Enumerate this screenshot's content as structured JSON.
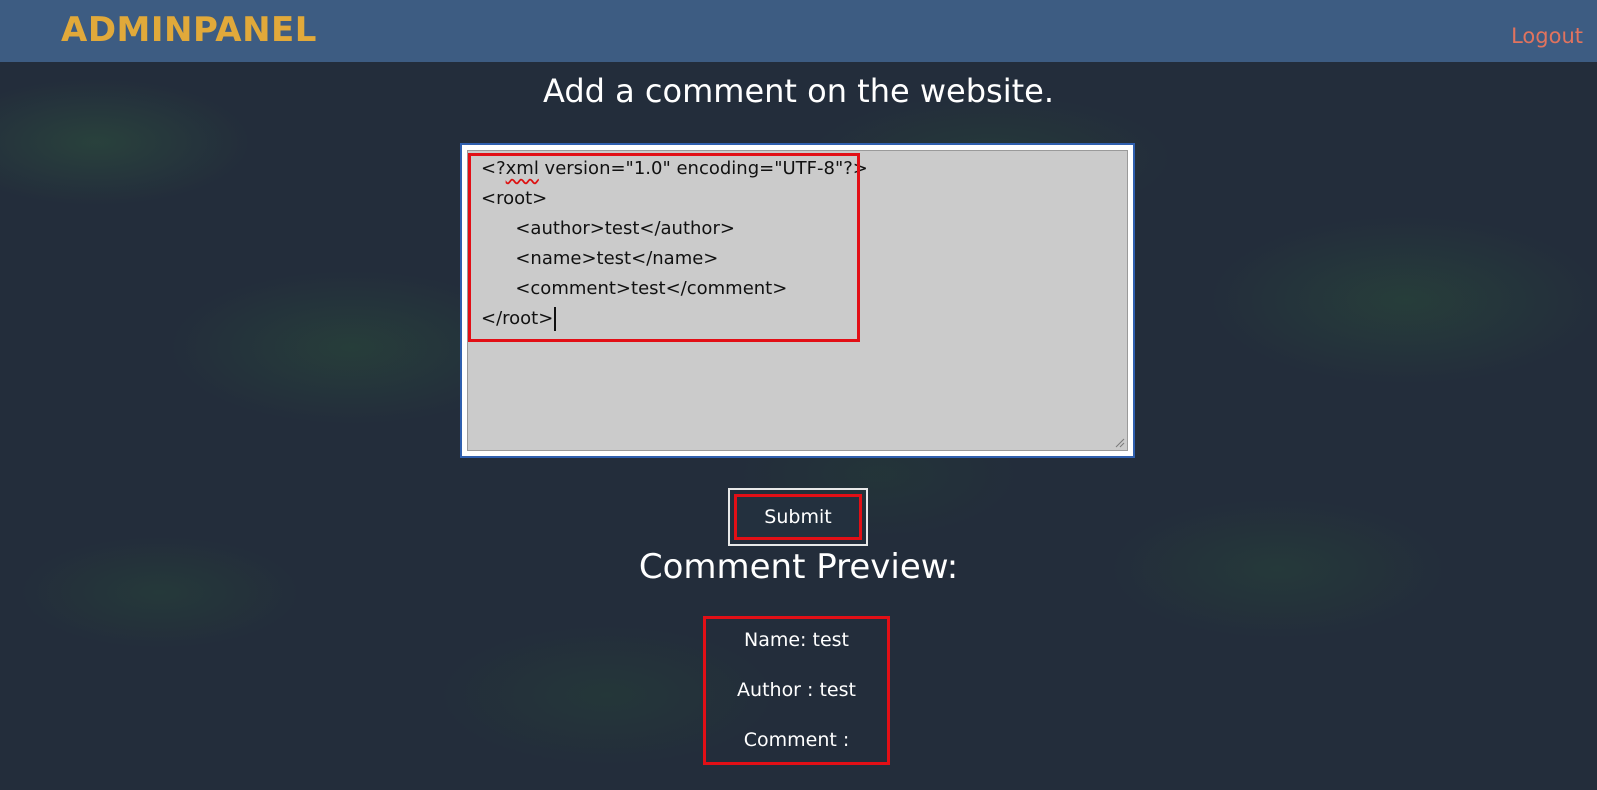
{
  "navbar": {
    "brand": "ADMINPANEL",
    "logout_label": "Logout",
    "brand_color": "#e1a93a",
    "logout_color": "#e1735e",
    "background_color": "#3d5c82"
  },
  "main": {
    "title": "Add a comment on the website.",
    "editor": {
      "lines": [
        "<?xml version=\"1.0\" encoding=\"UTF-8\"?>",
        "<root>",
        "      <author>test</author>",
        "      <name>test</name>",
        "      <comment>test</comment>",
        "</root>"
      ],
      "line0_parts": [
        "<?",
        "xml",
        " version=\"1.0\" encoding=\"UTF-8\"?>"
      ]
    },
    "submit_label": "Submit",
    "highlight_color": "#e20f16"
  },
  "preview": {
    "title": "Comment Preview:",
    "name_line": "Name: test",
    "author_line": "Author : test",
    "comment_line": "Comment :"
  }
}
